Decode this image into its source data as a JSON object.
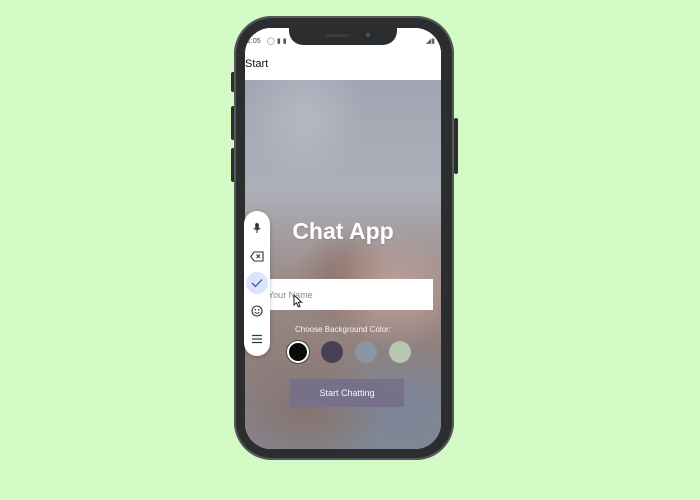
{
  "status_bar": {
    "time": "1:05",
    "icons": [
      "shield-icon",
      "sim-icon",
      "battery-icon"
    ]
  },
  "app_bar": {
    "title": "Start"
  },
  "main": {
    "heading": "Chat App",
    "name_input": {
      "value": "",
      "placeholder": "Your Name"
    },
    "bg_label": "Choose Background Color:",
    "colors": [
      {
        "name": "black",
        "hex": "#090c08",
        "selected": true
      },
      {
        "name": "purple-dark",
        "hex": "#474056",
        "selected": false
      },
      {
        "name": "gray-blue",
        "hex": "#8a95a5",
        "selected": false
      },
      {
        "name": "sage",
        "hex": "#b9c6ae",
        "selected": false
      }
    ],
    "start_button": "Start Chatting"
  },
  "side_toolbar": {
    "items": [
      "mic-icon",
      "backspace-icon",
      "check-icon",
      "emoji-icon",
      "menu-icon"
    ],
    "active": "check-icon"
  },
  "colors": {
    "page_background": "#d4fbc6",
    "phone_body": "#2b2d2f",
    "button_color": "#76708a",
    "toolbar_active": "#dbe4fb"
  }
}
